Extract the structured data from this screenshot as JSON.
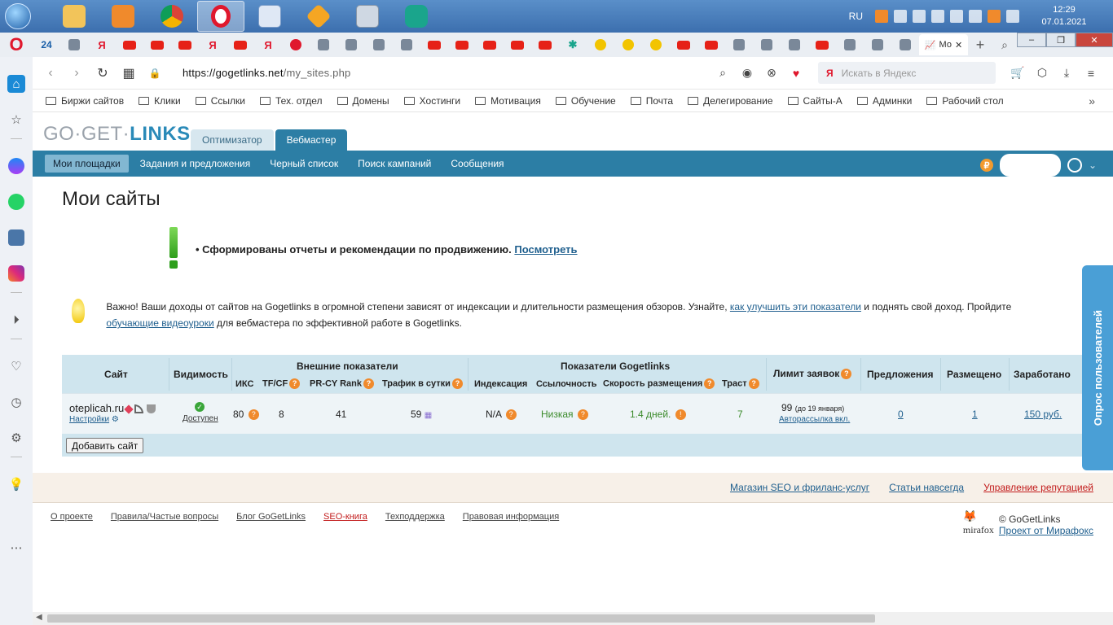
{
  "taskbar": {
    "apps": [
      "explorer",
      "media",
      "chrome",
      "opera",
      "wordpad",
      "eye",
      "calc",
      "eset"
    ],
    "tray_lang": "RU",
    "time": "12:29",
    "date": "07.01.2021"
  },
  "browser": {
    "active_tab_label": "Мо",
    "url_host": "https://gogetlinks.net",
    "url_path": "/my_sites.php",
    "search_placeholder": "Искать в Яндекс",
    "search_logo": "Я",
    "tab_count_badge": "24"
  },
  "bookmarks": [
    "Биржи сайтов",
    "Клики",
    "Ссылки",
    "Тех. отдел",
    "Домены",
    "Хостинги",
    "Мотивация",
    "Обучение",
    "Почта",
    "Делегирование",
    "Сайты-А",
    "Админки",
    "Рабочий стол"
  ],
  "site": {
    "logo_part1": "GO·GET·",
    "logo_part2": "LINKS",
    "role_tabs": [
      "Оптимизатор",
      "Вебмастер"
    ],
    "menu": [
      "Мои площадки",
      "Задания и предложения",
      "Черный список",
      "Поиск кампаний",
      "Сообщения"
    ],
    "currency_symbol": "₽"
  },
  "page": {
    "title": "Мои сайты",
    "notice": "Сформированы отчеты и рекомендации по продвижению.",
    "notice_link": "Посмотреть",
    "tip_part1": "Важно! Ваши доходы от сайтов на Gogetlinks в огромной степени зависят от индексации и длительности размещения обзоров. Узнайте,",
    "tip_link1": "как улучшить эти показатели",
    "tip_part2": "и поднять свой доход. Пройдите",
    "tip_link2": "обучающие видеоуроки",
    "tip_part3": "для вебмастера по эффективной работе в Gogetlinks."
  },
  "table": {
    "headers": {
      "site": "Сайт",
      "visibility": "Видимость",
      "external": "Внешние показатели",
      "iks": "ИКС",
      "tfcf": "TF/CF",
      "prcy": "PR-CY Rank",
      "traffic": "Трафик в сутки",
      "ggl": "Показатели Gogetlinks",
      "index": "Индексация",
      "linkage": "Ссылочность",
      "speed": "Скорость размещения",
      "trust": "Траст",
      "limit": "Лимит заявок",
      "offers": "Предложения",
      "placed": "Размещено",
      "earned": "Заработано"
    },
    "row": {
      "site": "oteplicah.ru",
      "settings": "Настройки",
      "status": "Доступен",
      "iks": "80",
      "tfcf": "8",
      "prcy": "41",
      "traffic": "59",
      "index": "N/A",
      "linkage": "Низкая",
      "speed": "1.4 дней.",
      "trust": "7",
      "limit": "99",
      "limit_note": "(до 19 января)",
      "autosend": "Авторассылка вкл.",
      "offers": "0",
      "placed": "1",
      "earned": "150 руб."
    },
    "add_button": "Добавить сайт"
  },
  "survey_label": "Опрос пользователей",
  "footer": {
    "top_links": [
      "Магазин SEO и фриланс-услуг",
      "Статьи навсегда",
      "Управление репутацией"
    ],
    "bottom_links": [
      "О проекте",
      "Правила/Частые вопросы",
      "Блог GoGetLinks",
      "SEO-книга",
      "Техподдержка",
      "Правовая информация"
    ],
    "copyright": "© GoGetLinks",
    "project_link": "Проект от Мирафокс",
    "mirafox": "mirafox"
  },
  "colors": {
    "brand": "#2c7ea5",
    "header_bg": "#cfe5ee",
    "warning": "#f08a2c",
    "green": "#3a8a2a"
  }
}
